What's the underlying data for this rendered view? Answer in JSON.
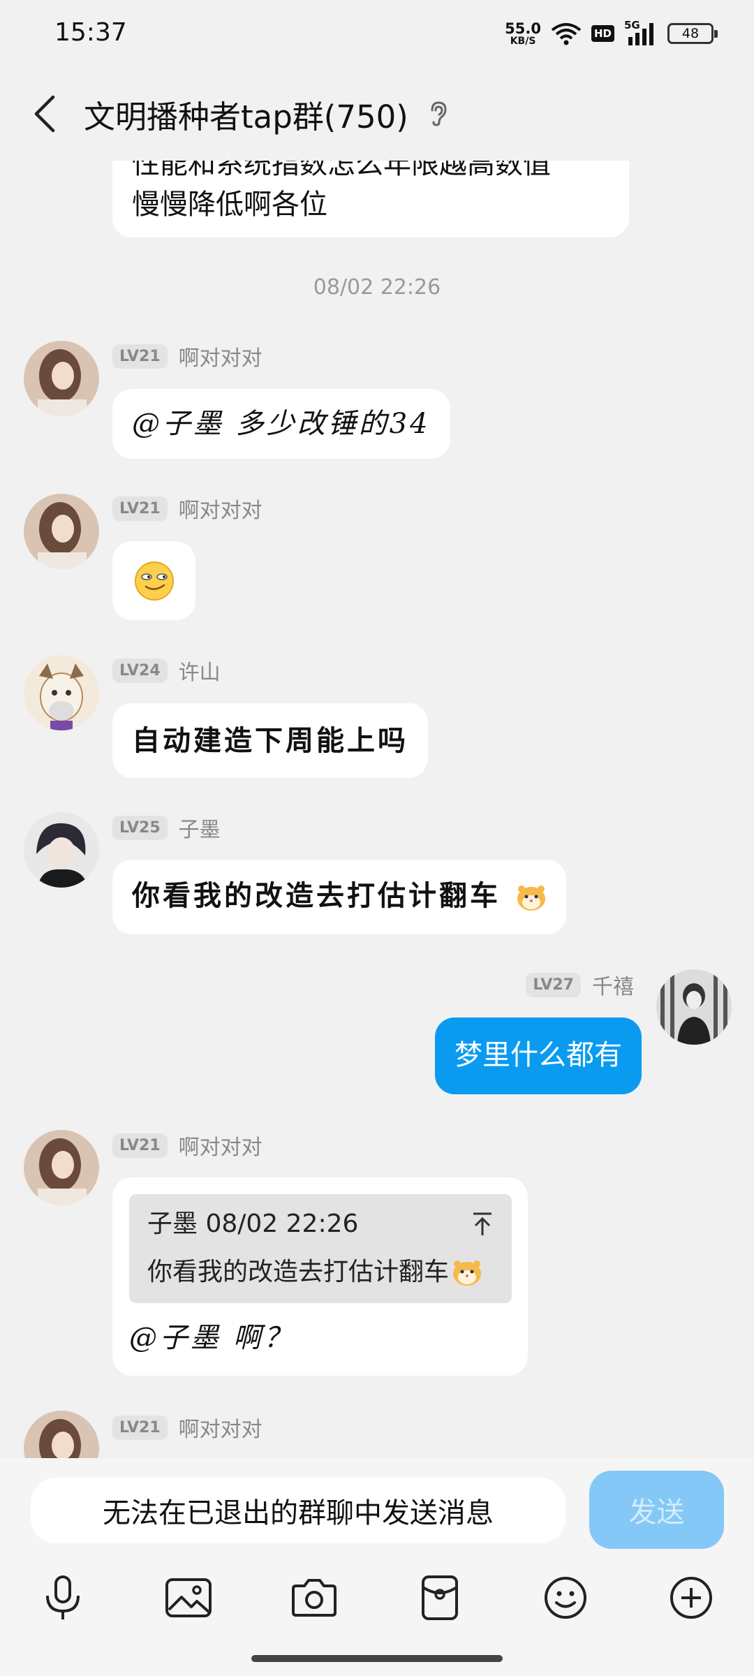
{
  "status_bar": {
    "time": "15:37",
    "net_speed": "55.0",
    "net_unit": "KB/S",
    "hd": "HD",
    "network": "5G",
    "battery": "48"
  },
  "header": {
    "title": "文明播种者tap群(750)"
  },
  "chat": {
    "partial_message": {
      "line1": "性能和系统指数怎么年限越高数值",
      "line2": "慢慢降低啊各位"
    },
    "timestamp": "08/02 22:26",
    "messages": [
      {
        "level": "LV21",
        "nick": "啊对对对",
        "text": "@子墨 多少改锤的34"
      },
      {
        "level": "LV21",
        "nick": "啊对对对",
        "emoji": "smirk-face"
      },
      {
        "level": "LV24",
        "nick": "许山",
        "text": "自动建造下周能上吗"
      },
      {
        "level": "LV25",
        "nick": "子墨",
        "text": "你看我的改造去打估计翻车"
      },
      {
        "level": "LV27",
        "nick": "千禧",
        "text": "梦里什么都有",
        "self": true
      },
      {
        "level": "LV21",
        "nick": "啊对对对",
        "quote": {
          "header": "子墨 08/02 22:26",
          "body": "你看我的改造去打估计翻车"
        },
        "text": "@子墨 啊？"
      },
      {
        "level": "LV21",
        "nick": "啊对对对"
      }
    ]
  },
  "input": {
    "placeholder": "无法在已退出的群聊中发送消息",
    "send_label": "发送"
  },
  "colors": {
    "accent": "#0a9bf0",
    "send_disabled": "#84c8f7",
    "background": "#f1f1f1"
  },
  "icons": [
    "back-icon",
    "ear-icon",
    "mic-icon",
    "image-icon",
    "camera-icon",
    "red-packet-icon",
    "emoji-icon",
    "plus-icon"
  ]
}
